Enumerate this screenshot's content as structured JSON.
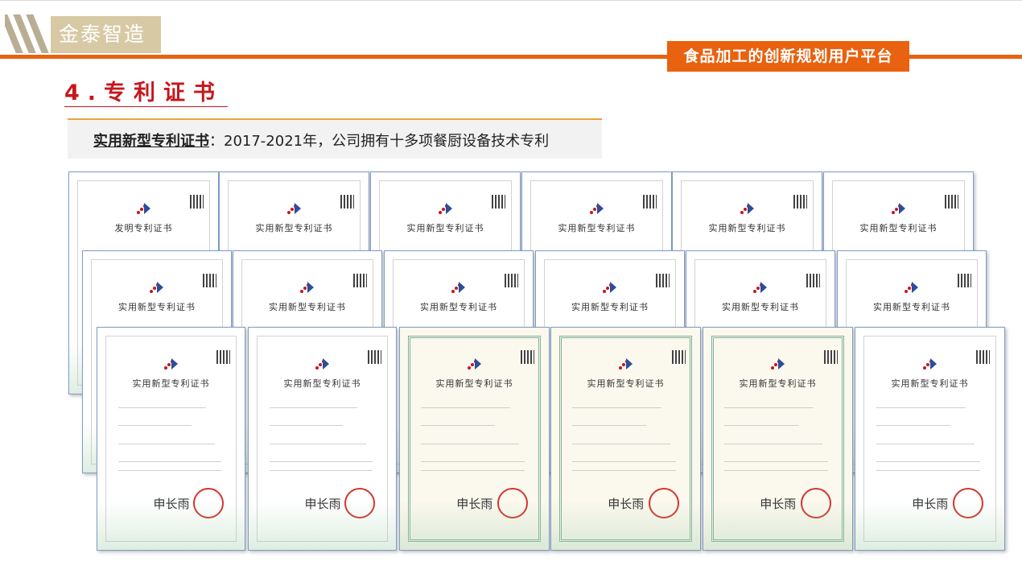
{
  "brand": {
    "logo_text": "金泰智造",
    "tagline": "食品加工的创新规划用户平台"
  },
  "section": {
    "title": "4.专利证书"
  },
  "subtitle": {
    "label": "实用新型专利证书",
    "separator": "：",
    "text": "2017-2021年，公司拥有十多项餐厨设备技术专利"
  },
  "certificates": [
    {
      "title": "发明专利证书"
    },
    {
      "title": "实用新型专利证书"
    },
    {
      "title": "实用新型专利证书"
    },
    {
      "title": "实用新型专利证书"
    },
    {
      "title": "实用新型专利证书"
    },
    {
      "title": "实用新型专利证书"
    },
    {
      "title": "实用新型专利证书"
    },
    {
      "title": "实用新型专利证书"
    },
    {
      "title": "实用新型专利证书"
    },
    {
      "title": "实用新型专利证书"
    },
    {
      "title": "实用新型专利证书"
    },
    {
      "title": "实用新型专利证书"
    },
    {
      "title": "实用新型专利证书"
    },
    {
      "title": "实用新型专利证书"
    },
    {
      "title": "实用新型专利证书"
    },
    {
      "title": "实用新型专利证书"
    },
    {
      "title": "实用新型专利证书"
    },
    {
      "title": "实用新型专利证书"
    }
  ],
  "colors": {
    "accent": "#e8620f",
    "title_red": "#c7161c",
    "logo_bg": "#d7c9a4",
    "cert_border": "#7e9cc6"
  }
}
